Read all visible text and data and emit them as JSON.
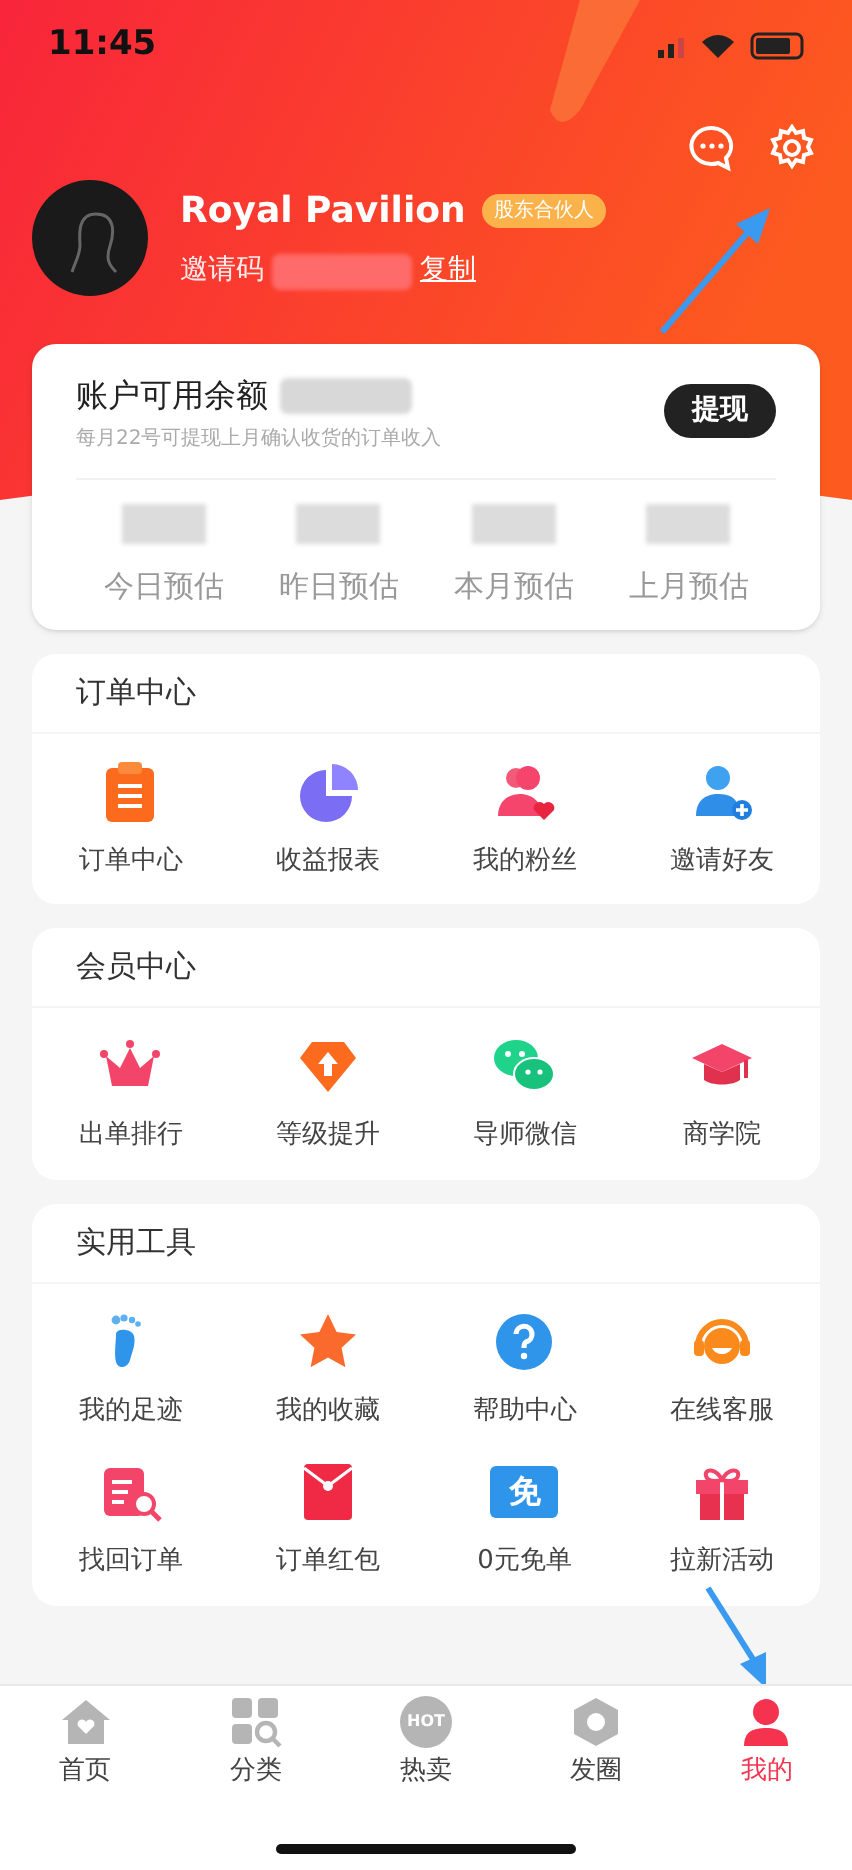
{
  "status_bar": {
    "time": "11:45"
  },
  "profile": {
    "name": "Royal Pavilion",
    "badge": "股东合伙人",
    "invite_label": "邀请码",
    "copy": "复制"
  },
  "balance": {
    "title": "账户可用余额",
    "note": "每月22号可提现上月确认收货的订单收入",
    "button": "提现",
    "stats": [
      {
        "label": "今日预估"
      },
      {
        "label": "昨日预估"
      },
      {
        "label": "本月预估"
      },
      {
        "label": "上月预估"
      }
    ]
  },
  "sections": [
    {
      "title": "订单中心",
      "items": [
        {
          "kind": "clipboard",
          "label": "订单中心"
        },
        {
          "kind": "pie",
          "label": "收益报表"
        },
        {
          "kind": "fans",
          "label": "我的粉丝"
        },
        {
          "kind": "invite",
          "label": "邀请好友"
        }
      ]
    },
    {
      "title": "会员中心",
      "items": [
        {
          "kind": "crown",
          "label": "出单排行"
        },
        {
          "kind": "upgrade",
          "label": "等级提升"
        },
        {
          "kind": "chat",
          "label": "导师微信"
        },
        {
          "kind": "cap",
          "label": "商学院"
        }
      ]
    },
    {
      "title": "实用工具",
      "items": [
        {
          "kind": "foot",
          "label": "我的足迹"
        },
        {
          "kind": "star",
          "label": "我的收藏"
        },
        {
          "kind": "help",
          "label": "帮助中心"
        },
        {
          "kind": "service",
          "label": "在线客服"
        },
        {
          "kind": "search-order",
          "label": "找回订单"
        },
        {
          "kind": "redpacket",
          "label": "订单红包"
        },
        {
          "kind": "free",
          "label": "0元免单",
          "glyph": "免"
        },
        {
          "kind": "gift",
          "label": "拉新活动"
        }
      ]
    }
  ],
  "tabs": [
    {
      "kind": "home",
      "label": "首页",
      "selected": false
    },
    {
      "kind": "category",
      "label": "分类",
      "selected": false
    },
    {
      "kind": "hot",
      "label": "热卖",
      "selected": false,
      "glyph": "HOT"
    },
    {
      "kind": "circle",
      "label": "发圈",
      "selected": false
    },
    {
      "kind": "me",
      "label": "我的",
      "selected": true
    }
  ]
}
